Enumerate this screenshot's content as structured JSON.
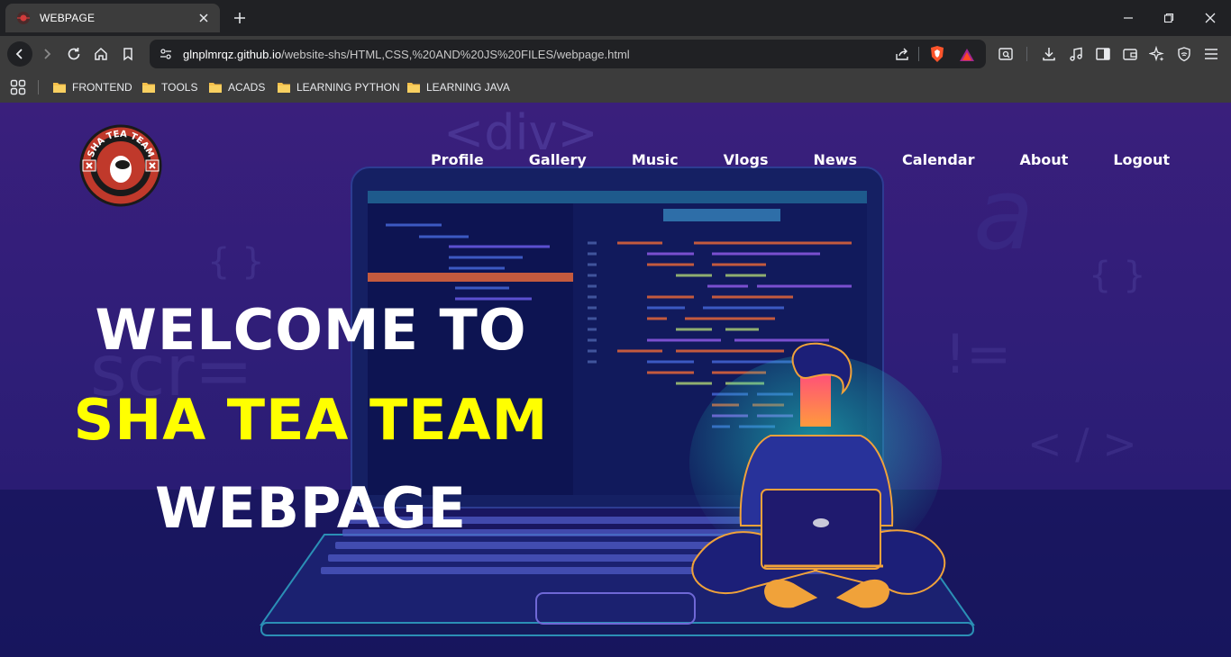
{
  "browser": {
    "tab": {
      "title": "WEBPAGE"
    },
    "url": {
      "host": "glnplmrqz.github.io",
      "path": "/website-shs/HTML,CSS,%20AND%20JS%20FILES/webpage.html"
    },
    "notification_count": "1",
    "bookmarks": [
      "FRONTEND",
      "TOOLS",
      "ACADS",
      "LEARNING PYTHON",
      "LEARNING JAVA"
    ]
  },
  "page": {
    "nav": [
      "Profile",
      "Gallery",
      "Music",
      "Vlogs",
      "News",
      "Calendar",
      "About",
      "Logout"
    ],
    "hero": {
      "line1": "WELCOME TO",
      "line2": "SHA TEA TEAM",
      "line3": "WEBPAGE"
    },
    "logo": {
      "top_text": "SHA TEA TEAM"
    },
    "background_code_glyphs": [
      "<div>",
      "{ }",
      "{ }",
      "scr=",
      "!=",
      "< / >",
      "a"
    ]
  },
  "colors": {
    "accent_yellow": "#ffff00",
    "bg_purple": "#2f1e78",
    "chrome_dark": "#202124",
    "chrome_mid": "#3c3c3c"
  }
}
